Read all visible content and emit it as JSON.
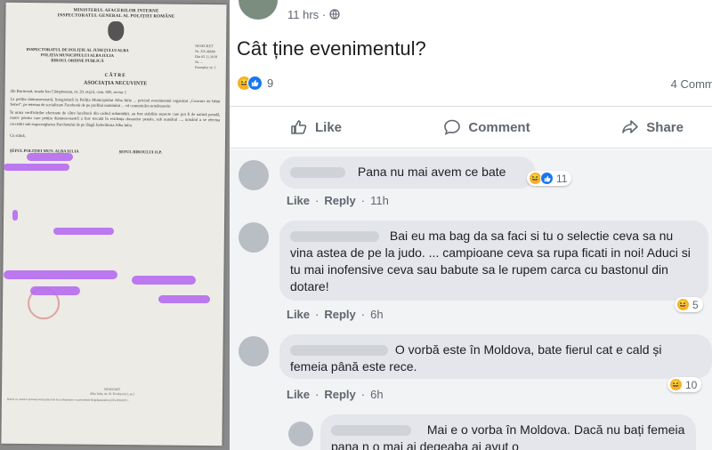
{
  "document": {
    "header_lines": [
      "MINISTERUL AFACERILOR INTERNE",
      "INSPECTORATUL GENERAL AL POLIȚIEI ROMÂNE"
    ],
    "header_right": [
      "NESECRET",
      "Nr. XX.4hhhh",
      "Din 05.11.2018",
      "Nr. ...",
      "Exemplar nr. 1"
    ],
    "sub_header": [
      "INSPECTORATUL DE POLIȚIE AL JUDEȚULUI ALBA",
      "POLIȚIA MUNICIPIULUI ALBA IULIA",
      "BIROUL ORDINE PUBLICĂ"
    ],
    "catre": "CĂTRE",
    "addressee": "ASOCIAȚIA NECUVINTE",
    "address_line": "din București, strada Ion Câmpineanu, nr. 20, etaj 6, cam. 605, sector 1",
    "body_paragraphs": [
      "La petiția dumneavoastră, înregistrată la Poliția Municipiului Alba Iulia ... privind evenimentul organizat „Concurs de bătut femei”, pe rețeaua de socializare Facebook de pe profilul numitului ... vă comunicăm următoarele:",
      "În urma verificărilor efectuate de către lucrătorii din cadrul subunității, au fost stabilite aspecte care pot fi de natură penală, motiv pentru care petiția dumneavoastră a fost trecută în evidența dosarelor penale, sub numărul ..., urmând a se efectua cercetări sub supravegherea Parchetului de pe lângă Judecătoria Alba Iulia."
    ],
    "closing": "Cu stimă,",
    "signature_left": "ȘEFUL POLIȚIEI MUN. ALBA IULIA",
    "signature_right": "ȘEFUL BIROULUI O.P.",
    "footer_center": [
      "NESECRET",
      "Alba Iulia, str. B. Teodorovici, nr.2"
    ],
    "footer_small": "Datele cu caracter personal sunt prelucrate în conformitate cu prevederile Regulamentului (UE) 2016/679 ..."
  },
  "post": {
    "time": "11 hrs · ",
    "globe_icon": "globe-icon",
    "text": "Cât ține evenimentul?",
    "reaction_count": "9",
    "comments_count": "4 Comme",
    "actions": [
      {
        "icon": "like-icon",
        "label": "Like"
      },
      {
        "icon": "comment-icon",
        "label": "Comment"
      },
      {
        "icon": "share-icon",
        "label": "Share"
      }
    ]
  },
  "comments": [
    {
      "text": "Pana nu mai avem ce bate",
      "like": "Like",
      "reply": "Reply",
      "time": "11h",
      "reactions": "11"
    },
    {
      "text": "Bai eu ma bag da sa faci si tu o selectie ceva sa nu vina astea de pe la judo. ... campioane ceva sa rupa ficati in noi! Aduci si tu mai inofensive ceva sau babute sa le rupem carca cu bastonul din dotare!",
      "like": "Like",
      "reply": "Reply",
      "time": "6h",
      "reactions": "5"
    },
    {
      "text": "O vorbă este în Moldova, bate fierul cat e cald și femeia până este rece.",
      "like": "Like",
      "reply": "Reply",
      "time": "6h",
      "reactions": "10"
    },
    {
      "text": "Mai e o vorba în Moldova. Dacă nu bați femeia pana n o mai ai degeaba ai avut o",
      "time": ""
    }
  ],
  "colors": {
    "facebook_blue": "#1877f2",
    "haha_yellow": "#f7b125",
    "bubble_gray": "#e4e6eb",
    "scribble_purple": "#b66cf0"
  }
}
